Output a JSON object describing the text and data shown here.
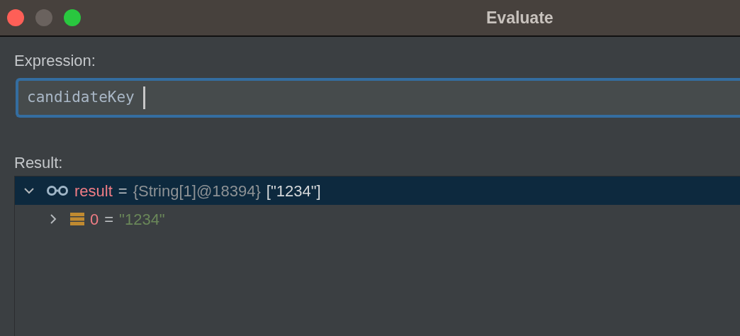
{
  "window": {
    "title": "Evaluate"
  },
  "expression": {
    "label": "Expression:",
    "value": "candidateKey ",
    "focused": true
  },
  "result": {
    "label": "Result:",
    "rows": [
      {
        "kind": "array",
        "name": "result",
        "equals": "=",
        "type_info": "{String[1]@18394}",
        "value": "[\"1234\"]",
        "expanded": true,
        "selected": true,
        "children": [
          {
            "kind": "field",
            "name": "0",
            "equals": "=",
            "value": "\"1234\"",
            "expanded": false,
            "selected": false
          }
        ]
      }
    ]
  }
}
